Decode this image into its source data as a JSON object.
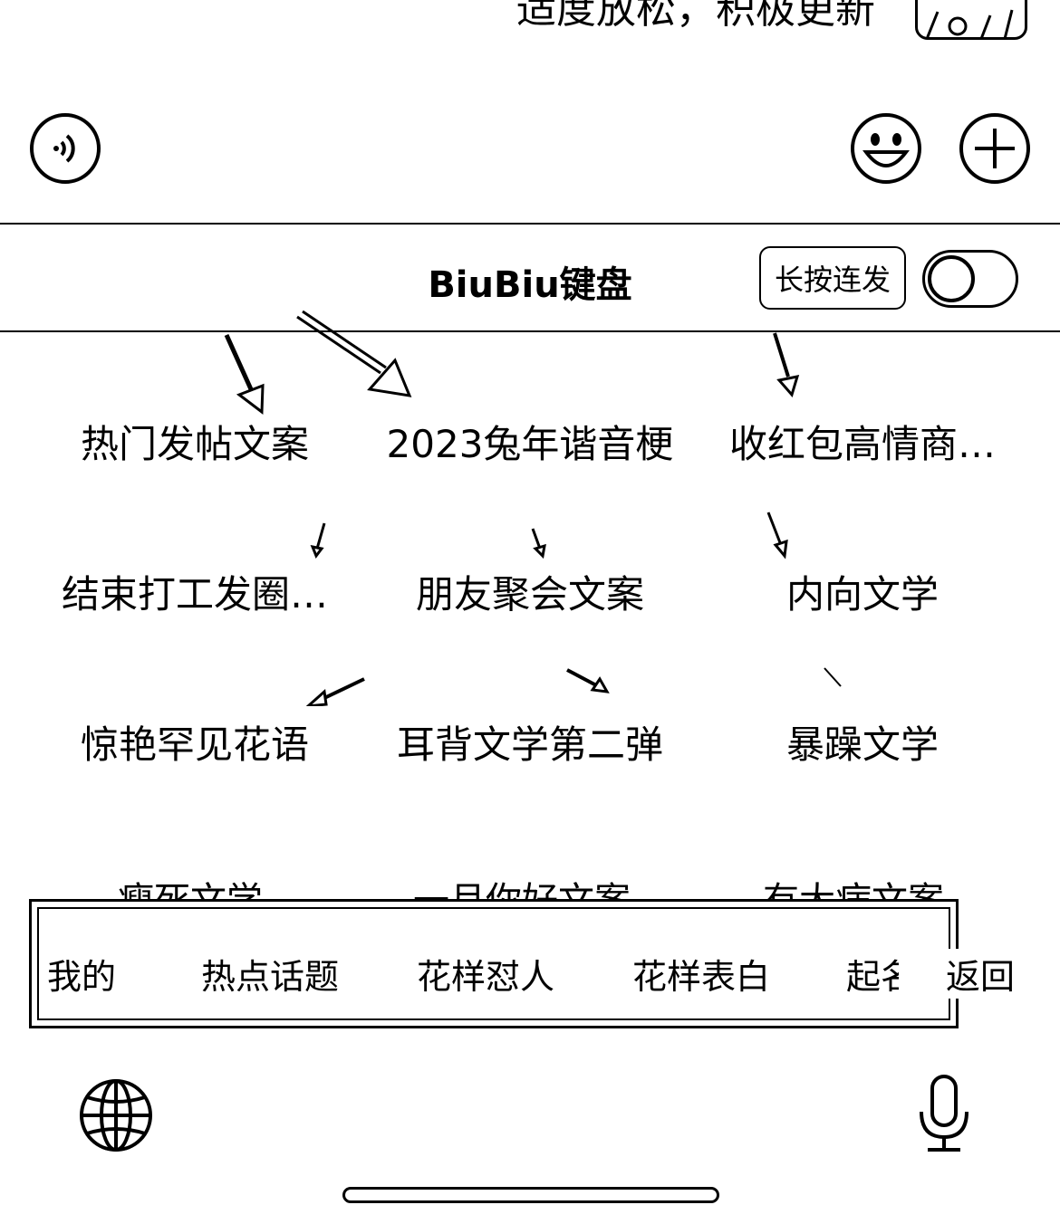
{
  "top_message": "适度放松，积极更新",
  "toolbar": {
    "voice_icon": "voice-icon",
    "emoji_icon": "emoji-icon",
    "add_icon": "plus-icon"
  },
  "keyboard": {
    "title": "BiuBiu键盘",
    "toggle_label": "长按连发",
    "toggle_on": false
  },
  "phrases": [
    "热门发帖文案",
    "2023兔年谐音梗",
    "收红包高情商…",
    "结束打工发圈…",
    "朋友聚会文案",
    "内向文学",
    "惊艳罕见花语",
    "耳背文学第二弹",
    "暴躁文学"
  ],
  "partial_row": [
    "瘦死文学",
    "一月你好文案",
    "有大病文案"
  ],
  "tabs": [
    "我的",
    "热点话题",
    "花样怼人",
    "花样表白",
    "起名"
  ],
  "back_label": "返回",
  "bottom": {
    "globe_icon": "globe-icon",
    "mic_icon": "microphone-icon"
  }
}
